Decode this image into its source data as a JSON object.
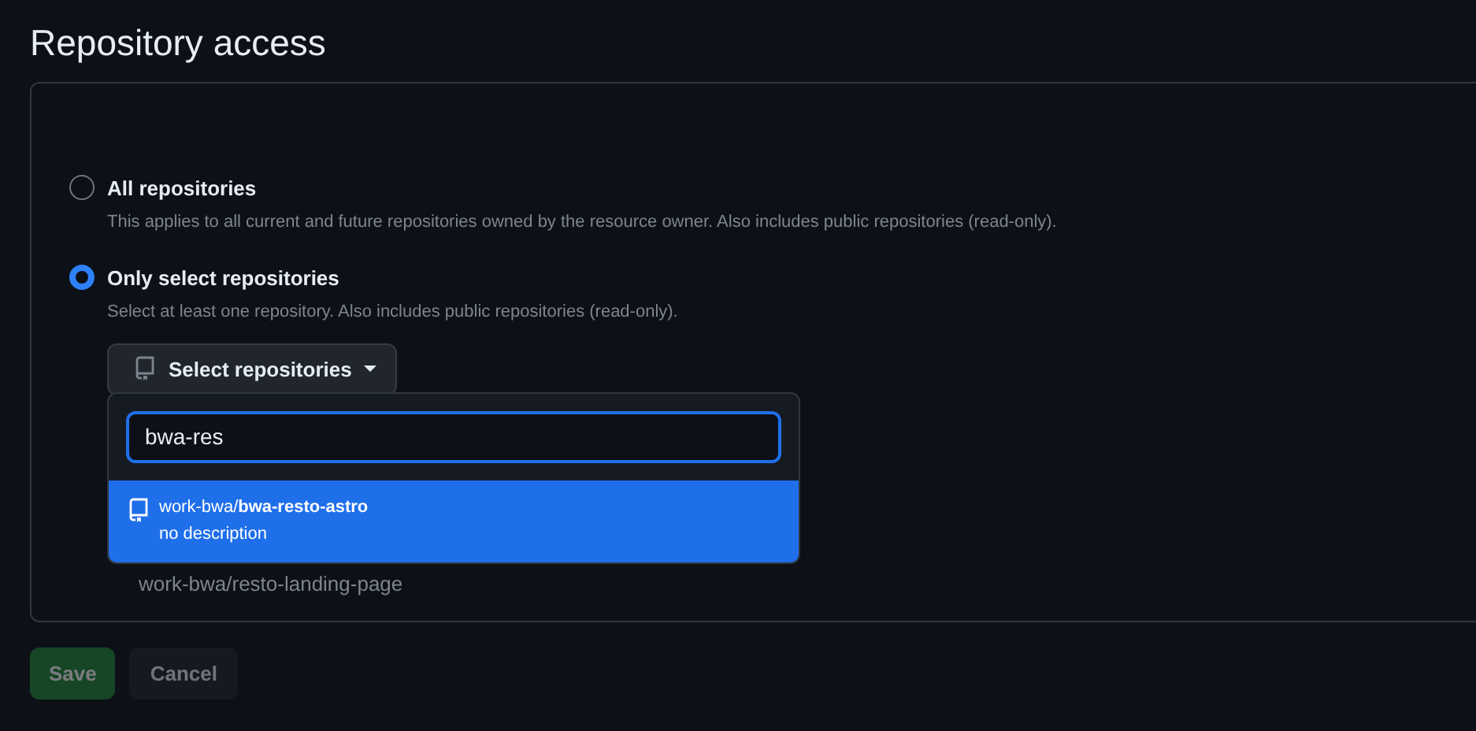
{
  "heading": "Repository access",
  "options": [
    {
      "label": "All repositories",
      "description": "This applies to all current and future repositories owned by the resource owner. Also includes public repositories (read-only).",
      "selected": false
    },
    {
      "label": "Only select repositories",
      "description": "Select at least one repository. Also includes public repositories (read-only).",
      "selected": true
    }
  ],
  "select_button": {
    "label": "Select repositories",
    "expanded": true
  },
  "behind_item": "work-bwa/resto-landing-page",
  "dropdown": {
    "search_value": "bwa-res",
    "results": [
      {
        "owner": "work-bwa/",
        "name": "bwa-resto-astro",
        "description": "no description",
        "selected": true
      }
    ]
  },
  "buttons": [
    {
      "label": "Save",
      "kind": "primary",
      "disabled": true
    },
    {
      "label": "Cancel",
      "kind": "secondary",
      "disabled": true
    }
  ]
}
